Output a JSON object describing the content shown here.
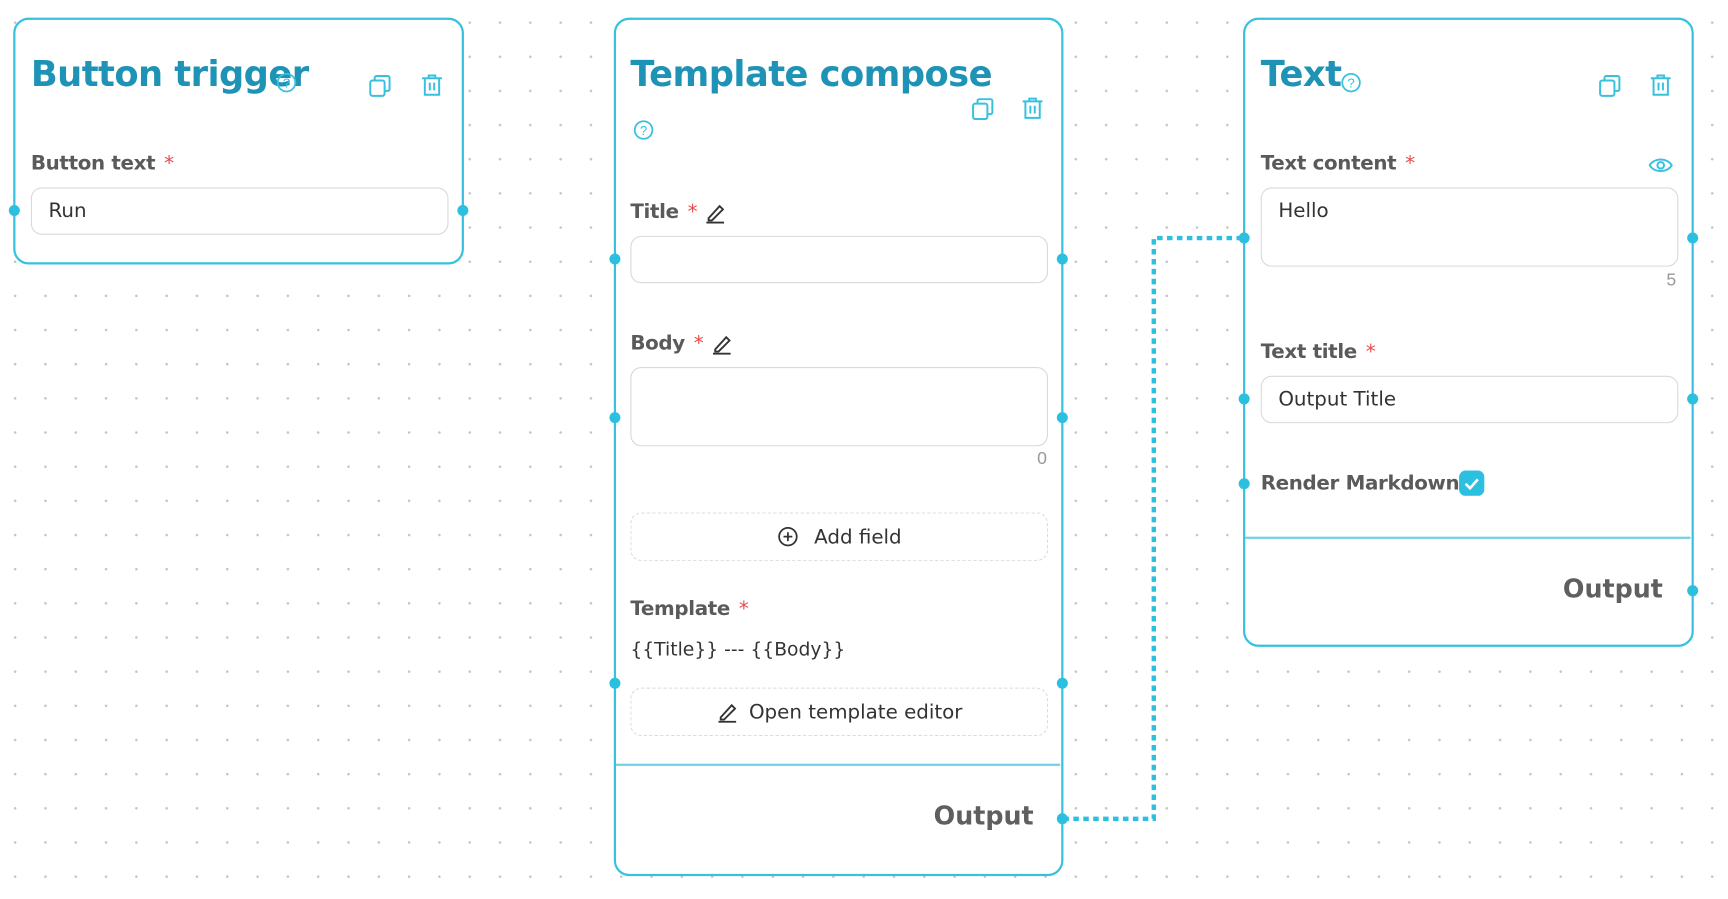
{
  "colors": {
    "accent": "#38c1df",
    "title": "#1f93b5",
    "required": "#e84a4a"
  },
  "nodes": {
    "button_trigger": {
      "title": "Button trigger",
      "fields": {
        "button_text": {
          "label": "Button text",
          "required": "*",
          "value": "Run"
        }
      },
      "icons": [
        "help-icon",
        "copy-icon",
        "trash-icon"
      ]
    },
    "template_compose": {
      "title": "Template compose",
      "fields": {
        "title": {
          "label": "Title",
          "required": "*",
          "value": ""
        },
        "body": {
          "label": "Body",
          "required": "*",
          "value": "",
          "char_count": "0"
        },
        "template": {
          "label": "Template",
          "required": "*",
          "value": "{{Title}} --- {{Body}}"
        }
      },
      "add_field_label": "Add field",
      "open_editor_label": "Open template editor",
      "output_label": "Output",
      "icons": [
        "help-icon",
        "copy-icon",
        "trash-icon",
        "pencil-icon",
        "plus-circle-icon"
      ]
    },
    "text": {
      "title": "Text",
      "fields": {
        "text_content": {
          "label": "Text content",
          "required": "*",
          "value": "Hello",
          "char_count": "5"
        },
        "text_title": {
          "label": "Text title",
          "required": "*",
          "value": "Output Title"
        },
        "render_markdown": {
          "label": "Render Markdown",
          "required": "*",
          "checked": true
        }
      },
      "output_label": "Output",
      "icons": [
        "help-icon",
        "copy-icon",
        "trash-icon",
        "eye-icon",
        "check-icon"
      ]
    }
  },
  "connections": [
    {
      "from": "template_compose.output",
      "to": "text.text_content"
    }
  ]
}
